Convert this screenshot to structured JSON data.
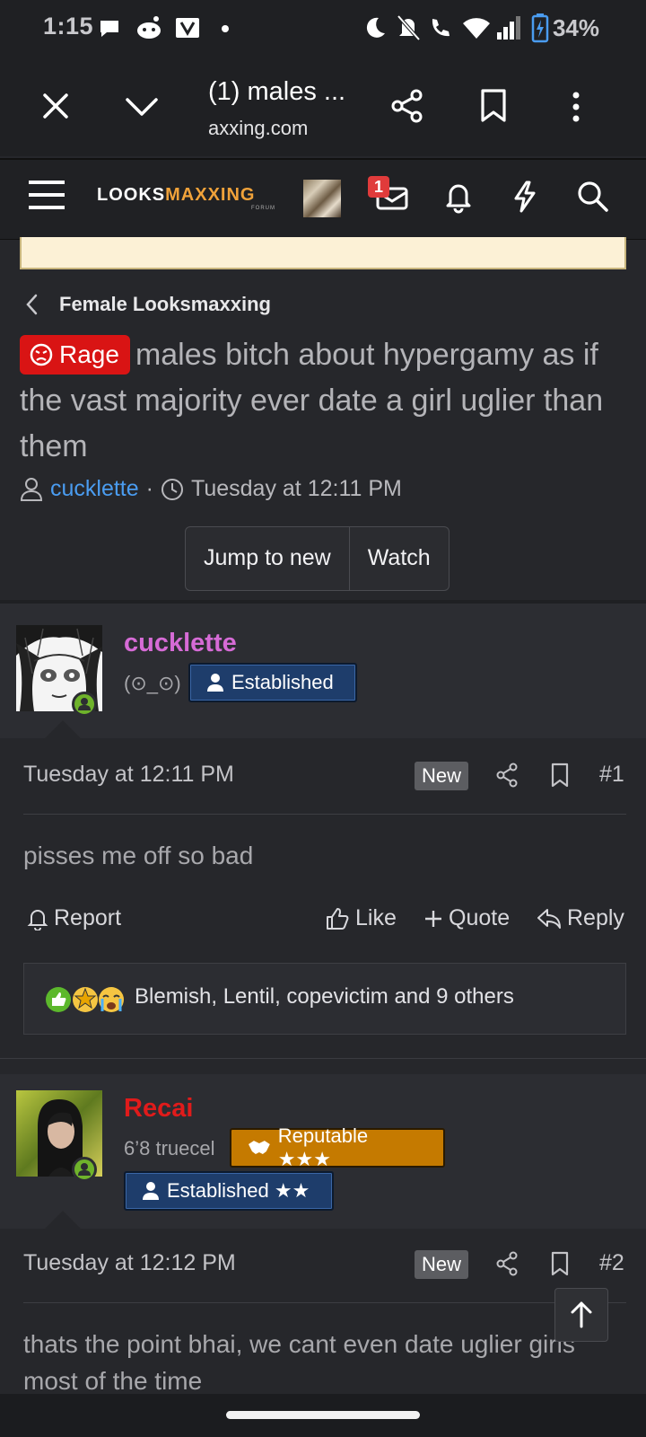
{
  "status_bar": {
    "time": "1:15",
    "battery": "34%"
  },
  "browser": {
    "tab_title": "(1) males ...",
    "url": "axxing.com"
  },
  "site": {
    "logo_left": "LOOKS",
    "logo_right": "MAXXING",
    "logo_sub": "FORUM",
    "inbox_count": "1"
  },
  "thread": {
    "breadcrumb": "Female Looksmaxxing",
    "prefix": "Rage",
    "title": "males bitch about hypergamy as if the vast majority ever date a girl uglier than them",
    "author": "cucklette",
    "separator": "·",
    "started": "Tuesday at 12:11 PM",
    "buttons": {
      "jump": "Jump to new",
      "watch": "Watch"
    }
  },
  "posts": [
    {
      "username": "cucklette",
      "user_title": "(⊙_⊙)",
      "banners": [
        "Established"
      ],
      "date": "Tuesday at 12:11 PM",
      "new_tag": "New",
      "number": "#1",
      "text": "pisses me off so bad",
      "actions": {
        "report": "Report",
        "like": "Like",
        "quote": "Quote",
        "reply": "Reply"
      },
      "reactions": "Blemish, Lentil, copevictim and 9 others"
    },
    {
      "username": "Recai",
      "user_title": "6’8 truecel",
      "banners": [
        "Reputable ★★★",
        "Established ★★"
      ],
      "date": "Tuesday at 12:12 PM",
      "new_tag": "New",
      "number": "#2",
      "text": "thats the point bhai, we cant even date uglier girls most of the time"
    }
  ],
  "colors": {
    "background": "#26272b",
    "link": "#4a9cf0",
    "prefix_red": "#d91414",
    "username_pink": "#d66bd6",
    "username_red": "#e01b1b",
    "established_blue": "#1e3d6b",
    "reputable_orange": "#c57a00",
    "online_green": "#6fb32b"
  }
}
